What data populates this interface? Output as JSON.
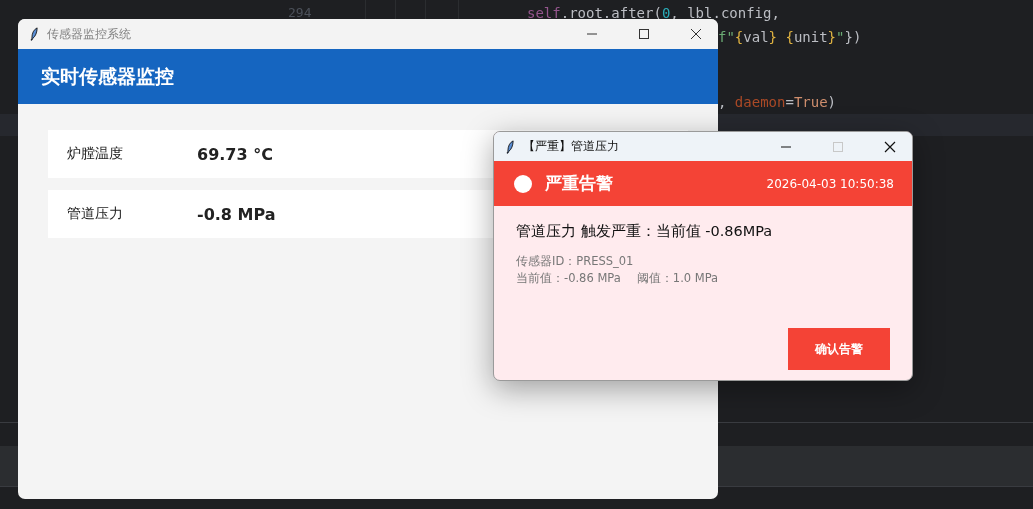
{
  "editor": {
    "line_number": "294",
    "code_lines": [
      {
        "tokens": [
          {
            "kind": "self",
            "text": "self"
          },
          {
            "kind": "plain",
            "text": ".root.after("
          },
          {
            "kind": "number",
            "text": "0"
          },
          {
            "kind": "plain",
            "text": ", lbl.config,"
          }
        ]
      },
      {
        "tokens": [
          {
            "kind": "string",
            "text": "f\""
          },
          {
            "kind": "brace",
            "text": "{"
          },
          {
            "kind": "plain",
            "text": "val"
          },
          {
            "kind": "brace",
            "text": "}"
          },
          {
            "kind": "brace",
            "text": " {"
          },
          {
            "kind": "plain",
            "text": "unit"
          },
          {
            "kind": "brace",
            "text": "}"
          },
          {
            "kind": "string",
            "text": "\""
          },
          {
            "kind": "plain",
            "text": "})"
          }
        ]
      },
      {
        "tokens": [
          {
            "kind": "plain",
            "text": ", "
          },
          {
            "kind": "param",
            "text": "daemon"
          },
          {
            "kind": "plain",
            "text": "="
          },
          {
            "kind": "keyword",
            "text": "True"
          },
          {
            "kind": "plain",
            "text": ")"
          }
        ]
      }
    ]
  },
  "main_window": {
    "title": "传感器监控系统",
    "maximize_disabled": false,
    "header": "实时传感器监控",
    "sensors": [
      {
        "label": "炉膛温度",
        "value": "69.73 °C"
      },
      {
        "label": "管道压力",
        "value": "-0.8 MPa"
      }
    ]
  },
  "alert_window": {
    "title": "【严重】管道压力",
    "maximize_disabled": true,
    "severity": "严重告警",
    "color": "#f44336",
    "timestamp": "2026-04-03 10:50:38",
    "message": "管道压力 触发严重：当前值 -0.86MPa",
    "sensor_id": "传感器ID：PRESS_01",
    "current": "当前值：-0.86 MPa",
    "threshold": "阈值：1.0 MPa",
    "button": "确认告警"
  }
}
